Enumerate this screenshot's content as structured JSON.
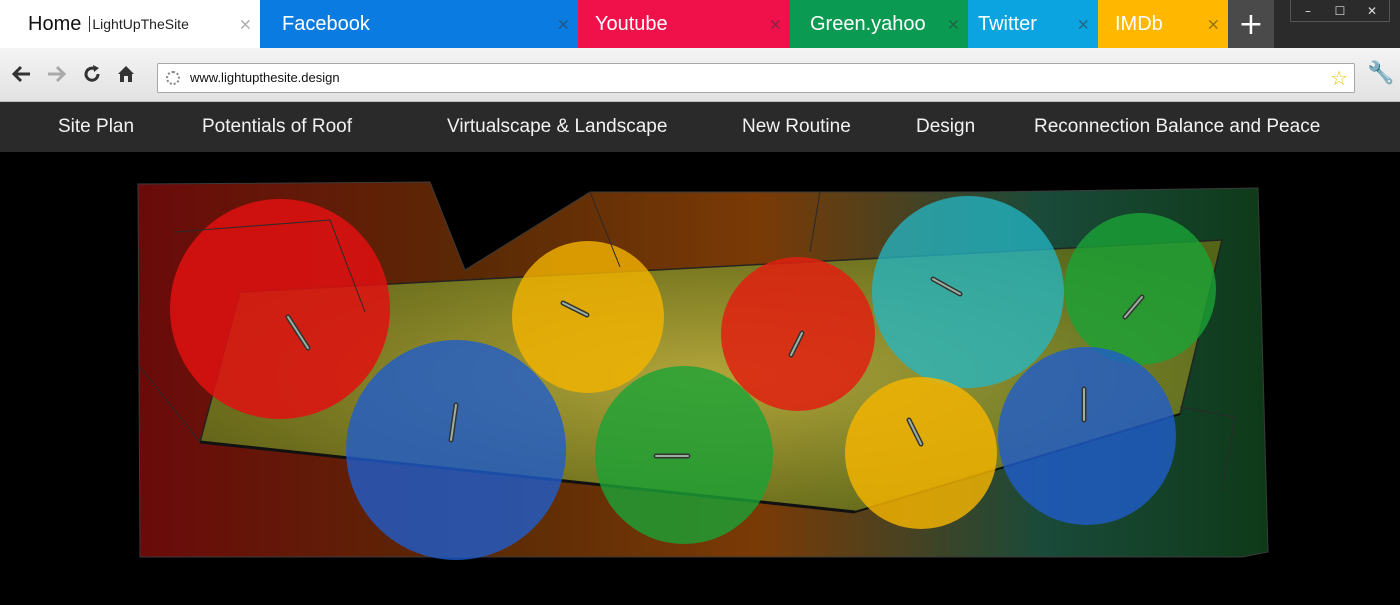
{
  "browser": {
    "tabs": [
      {
        "label": "Home",
        "sub": "LightUpTheSite",
        "color": "#ffffff"
      },
      {
        "label": "Facebook",
        "color": "#0a7be0"
      },
      {
        "label": "Youtube",
        "color": "#f0114b"
      },
      {
        "label": "Green.yahoo",
        "color": "#0a9a52"
      },
      {
        "label": "Twitter",
        "color": "#0ba3e0"
      },
      {
        "label": "IMDb",
        "color": "#ffb700"
      }
    ],
    "new_tab_symbol": "+",
    "tab_close_symbol": "×",
    "window_controls": {
      "minimize": "–",
      "maximize": "☐",
      "close": "✕"
    },
    "url": "www.lightupthesite.design",
    "icons": [
      "back-arrow-icon",
      "forward-arrow-icon",
      "reload-icon",
      "home-icon",
      "page-icon",
      "star-icon",
      "wrench-icon"
    ]
  },
  "site_nav": {
    "items": [
      {
        "label": "Site Plan"
      },
      {
        "label": "Potentials of Roof"
      },
      {
        "label": "Virtualscape & Landscape"
      },
      {
        "label": "New Routine"
      },
      {
        "label": "Design"
      },
      {
        "label": "Reconnection Balance and Peace"
      }
    ]
  },
  "hero": {
    "light_colors": {
      "red": "#e01010",
      "yellow": "#f5b400",
      "green": "#1aa336",
      "blue": "#1f5ccc",
      "cyan": "#23b8c8"
    }
  }
}
